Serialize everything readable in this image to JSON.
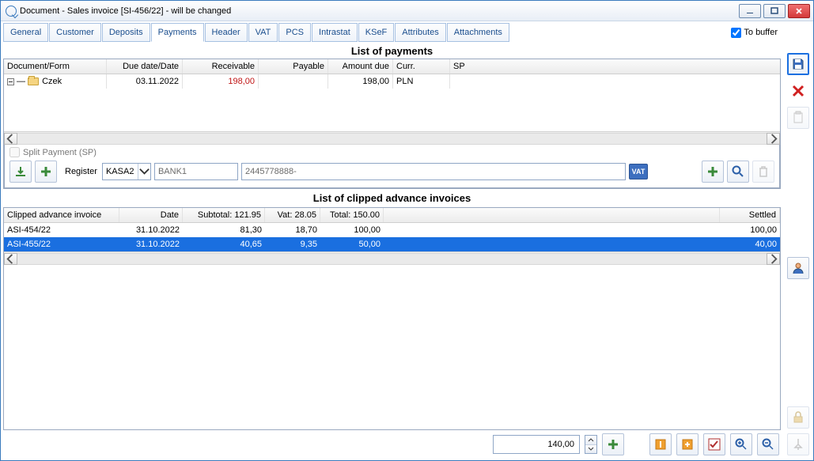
{
  "window": {
    "title": "Document - Sales invoice [SI-456/22]  - will be changed"
  },
  "tabs": [
    "General",
    "Customer",
    "Deposits",
    "Payments",
    "Header",
    "VAT",
    "PCS",
    "Intrastat",
    "KSeF",
    "Attributes",
    "Attachments"
  ],
  "active_tab_index": 3,
  "to_buffer_label": "To buffer",
  "to_buffer_checked": true,
  "payments": {
    "title": "List of payments",
    "columns": {
      "doc": "Document/Form",
      "due": "Due date/Date",
      "recv": "Receivable",
      "payable": "Payable",
      "amt": "Amount due",
      "curr": "Curr.",
      "sp": "SP"
    },
    "rows": [
      {
        "doc": "Czek",
        "due": "03.11.2022",
        "recv": "198,00",
        "payable": "",
        "amt": "198,00",
        "curr": "PLN",
        "sp": ""
      }
    ]
  },
  "split_payment_label": "Split Payment (SP)",
  "split_payment_checked": false,
  "register": {
    "label": "Register",
    "selected": "KASA2",
    "bank": "BANK1",
    "account": "2445778888-",
    "vat_label": "VAT"
  },
  "clipped": {
    "title": "List of clipped advance invoices",
    "columns": {
      "inv": "Clipped advance invoice",
      "date": "Date",
      "sub": "Subtotal: 121.95",
      "vat": "Vat: 28.05",
      "total": "Total: 150.00",
      "settled": "Settled"
    },
    "rows": [
      {
        "inv": "ASI-454/22",
        "date": "31.10.2022",
        "sub": "81,30",
        "vat": "18,70",
        "total": "100,00",
        "settled": "100,00",
        "selected": false
      },
      {
        "inv": "ASI-455/22",
        "date": "31.10.2022",
        "sub": "40,65",
        "vat": "9,35",
        "total": "50,00",
        "settled": "40,00",
        "selected": true
      }
    ]
  },
  "bottom": {
    "amount": "140,00"
  },
  "chart_data": {
    "type": "table",
    "title": "List of clipped advance invoices",
    "columns": [
      "Clipped advance invoice",
      "Date",
      "Subtotal",
      "Vat",
      "Total",
      "Settled"
    ],
    "rows": [
      [
        "ASI-454/22",
        "31.10.2022",
        81.3,
        18.7,
        100.0,
        100.0
      ],
      [
        "ASI-455/22",
        "31.10.2022",
        40.65,
        9.35,
        50.0,
        40.0
      ]
    ],
    "totals": {
      "Subtotal": 121.95,
      "Vat": 28.05,
      "Total": 150.0
    }
  }
}
